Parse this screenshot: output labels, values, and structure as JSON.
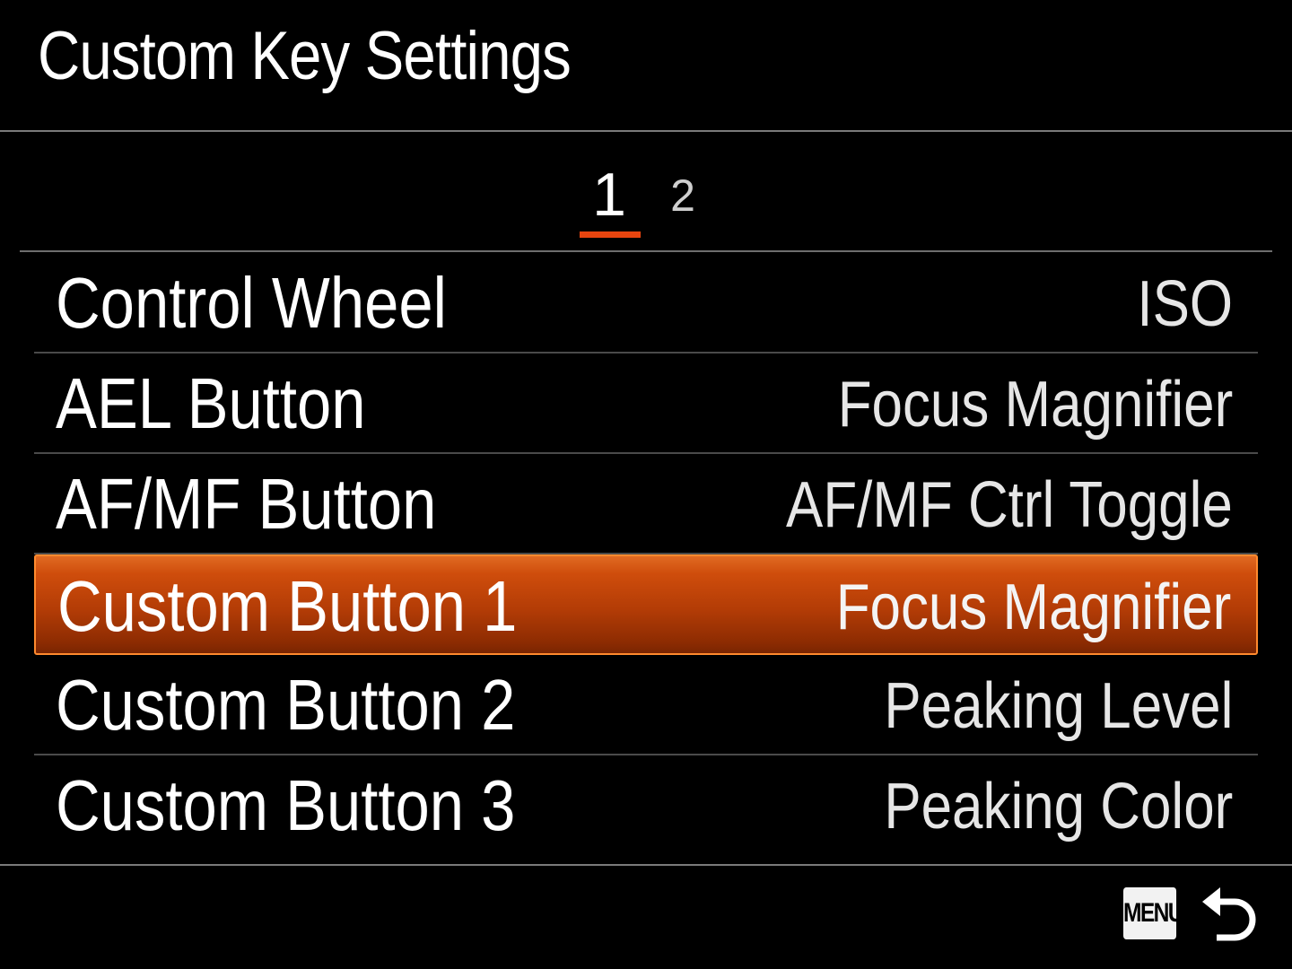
{
  "header": {
    "title": "Custom Key Settings"
  },
  "pager": {
    "pages": [
      "1",
      "2"
    ],
    "active_page": "1",
    "accent_color": "#e8450f"
  },
  "menu": {
    "items": [
      {
        "label": "Control Wheel",
        "value": "ISO",
        "selected": false
      },
      {
        "label": "AEL Button",
        "value": "Focus Magnifier",
        "selected": false
      },
      {
        "label": "AF/MF Button",
        "value": "AF/MF Ctrl Toggle",
        "selected": false
      },
      {
        "label": "Custom Button 1",
        "value": "Focus Magnifier",
        "selected": true
      },
      {
        "label": "Custom Button 2",
        "value": "Peaking Level",
        "selected": false
      },
      {
        "label": "Custom Button 3",
        "value": "Peaking Color",
        "selected": false
      }
    ],
    "highlight_color": "#c2410a"
  },
  "footer": {
    "menu_key_label": "MENU",
    "back_icon": "return-arrow-icon"
  }
}
